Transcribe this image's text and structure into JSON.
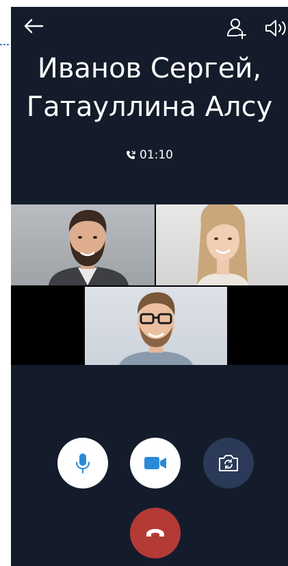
{
  "call": {
    "title_line1": "Иванов Сергей,",
    "title_line2": "Гатауллина Алсу",
    "duration": "01:10"
  },
  "icons": {
    "back": "arrow-left-icon",
    "add_participant": "add-user-icon",
    "speaker": "speaker-icon",
    "timer": "call-timer-icon",
    "microphone": "microphone-icon",
    "camera": "video-camera-icon",
    "flip_camera": "flip-camera-icon",
    "hangup": "hangup-icon"
  },
  "participants": [
    {
      "tile": "video-tile-1",
      "description": "bearded man in suit"
    },
    {
      "tile": "video-tile-2",
      "description": "smiling woman"
    },
    {
      "tile": "video-tile-3",
      "description": "man with glasses"
    }
  ],
  "colors": {
    "background": "#141c2b",
    "accent": "#2b8ad8",
    "hangup": "#b33a35",
    "flip_button": "#2a3a58"
  }
}
